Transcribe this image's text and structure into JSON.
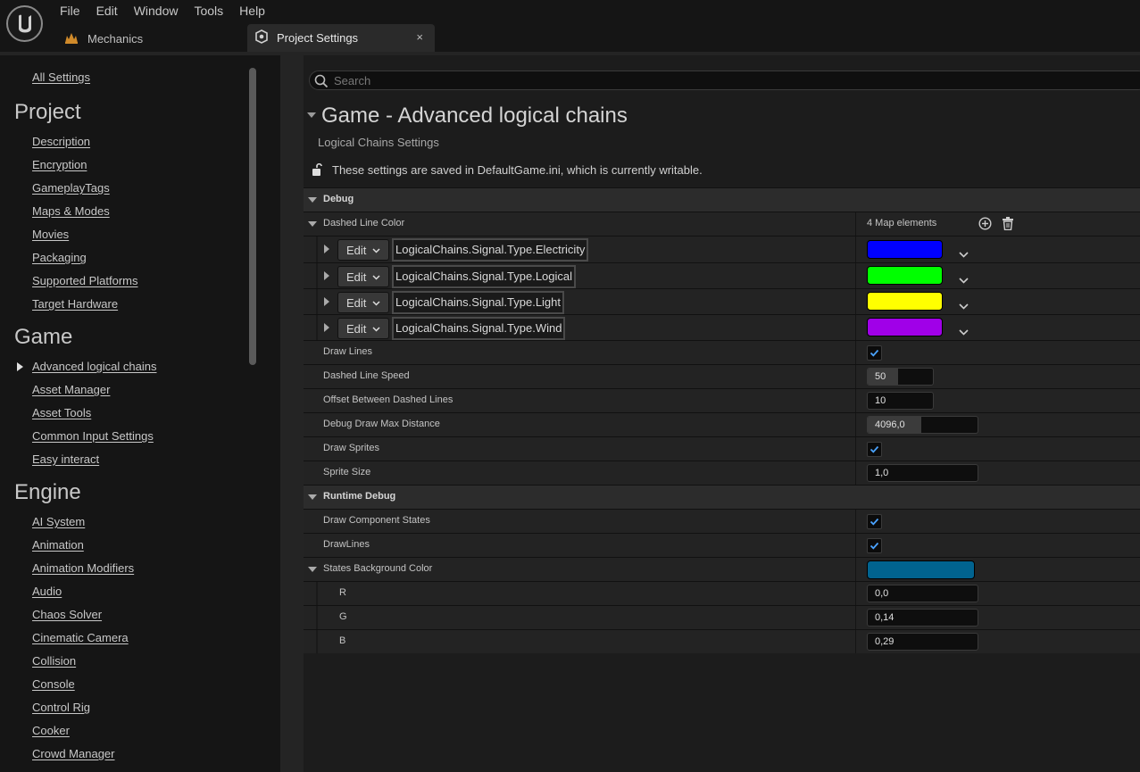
{
  "menu": [
    "File",
    "Edit",
    "Window",
    "Tools",
    "Help"
  ],
  "project_tab": {
    "label": "Mechanics",
    "icon": "project-icon"
  },
  "settings_tab": {
    "label": "Project Settings",
    "close_glyph": "×",
    "icon": "settings-icon"
  },
  "sidebar": {
    "all_settings": "All Settings",
    "sections": [
      {
        "heading": "Project",
        "items": [
          "Description",
          "Encryption",
          "GameplayTags",
          "Maps & Modes",
          "Movies",
          "Packaging",
          "Supported Platforms",
          "Target Hardware"
        ]
      },
      {
        "heading": "Game",
        "items": [
          "Advanced logical chains",
          "Asset Manager",
          "Asset Tools",
          "Common Input Settings",
          "Easy interact"
        ]
      },
      {
        "heading": "Engine",
        "items": [
          "AI System",
          "Animation",
          "Animation Modifiers",
          "Audio",
          "Chaos Solver",
          "Cinematic Camera",
          "Collision",
          "Console",
          "Control Rig",
          "Cooker",
          "Crowd Manager"
        ]
      }
    ],
    "selected": "Advanced logical chains"
  },
  "search": {
    "placeholder": "Search",
    "value": ""
  },
  "page": {
    "title": "Game - Advanced logical chains",
    "subtitle": "Logical Chains Settings",
    "writable_note": "These settings are saved in DefaultGame.ini, which is currently writable."
  },
  "debug": {
    "category": "Debug",
    "dashed_line_color": {
      "label": "Dashed Line Color",
      "count_text": "4 Map elements",
      "entries": [
        {
          "edit": "Edit",
          "key": "LogicalChains.Signal.Type.Electricity",
          "color": "#0000ff"
        },
        {
          "edit": "Edit",
          "key": "LogicalChains.Signal.Type.Logical",
          "color": "#00ff00"
        },
        {
          "edit": "Edit",
          "key": "LogicalChains.Signal.Type.Light",
          "color": "#ffff00"
        },
        {
          "edit": "Edit",
          "key": "LogicalChains.Signal.Type.Wind",
          "color": "#a000e8"
        }
      ]
    },
    "draw_lines": {
      "label": "Draw Lines",
      "checked": true
    },
    "dashed_line_speed": {
      "label": "Dashed Line Speed",
      "value": "50"
    },
    "offset_between": {
      "label": "Offset Between Dashed Lines",
      "value": "10"
    },
    "max_distance": {
      "label": "Debug Draw Max Distance",
      "value": "4096,0"
    },
    "draw_sprites": {
      "label": "Draw Sprites",
      "checked": true
    },
    "sprite_size": {
      "label": "Sprite Size",
      "value": "1,0"
    }
  },
  "runtime_debug": {
    "category": "Runtime Debug",
    "draw_component_states": {
      "label": "Draw Component States",
      "checked": true
    },
    "drawlines": {
      "label": "DrawLines",
      "checked": true
    },
    "states_bg": {
      "label": "States Background Color",
      "color": "#01638f",
      "r": {
        "label": "R",
        "value": "0,0"
      },
      "g": {
        "label": "G",
        "value": "0,14"
      },
      "b": {
        "label": "B",
        "value": "0,29"
      }
    }
  },
  "colors": {
    "accent_check": "#4aa3ff",
    "panel_bg": "#1c1c1c",
    "category_bg": "#2c2c2c"
  }
}
